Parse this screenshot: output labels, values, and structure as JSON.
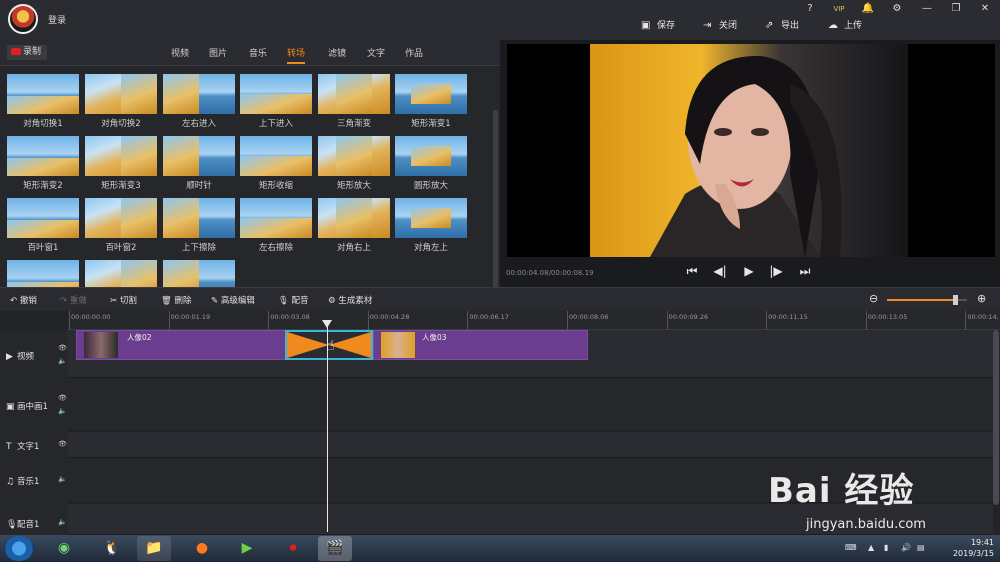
{
  "topbar": {
    "login": "登录",
    "window_buttons": [
      "?",
      "VIP",
      "🔔",
      "⚙",
      "—",
      "❐",
      "✕"
    ],
    "actions": [
      {
        "label": "保存",
        "icon": "save-icon"
      },
      {
        "label": "关闭",
        "icon": "close-project-icon"
      },
      {
        "label": "导出",
        "icon": "export-icon"
      },
      {
        "label": "上传",
        "icon": "upload-icon"
      }
    ]
  },
  "library": {
    "record_label": "录制",
    "tabs": [
      "视频",
      "图片",
      "音乐",
      "转场",
      "滤镜",
      "文字",
      "作品"
    ],
    "active_tab": "转场",
    "transitions": [
      "对角切换1",
      "对角切换2",
      "左右进入",
      "上下进入",
      "三角渐变",
      "矩形渐变1",
      "矩形渐变2",
      "矩形渐变3",
      "顺时针",
      "矩形收缩",
      "矩形放大",
      "圆形放大",
      "百叶窗1",
      "百叶窗2",
      "上下擦除",
      "左右擦除",
      "对角右上",
      "对角左上",
      "",
      "",
      ""
    ]
  },
  "preview": {
    "timecode": "00:00:04.08/00:00:08.19"
  },
  "edit_toolbar": {
    "undo": "撤销",
    "redo": "重做",
    "cut": "切割",
    "delete": "删除",
    "advanced": "高级编辑",
    "dub": "配音",
    "generate": "生成素材",
    "zoom_level": 0.85
  },
  "timeline": {
    "ruler": [
      "00:00:00.00",
      "00:00:01.19",
      "00:00:03.08",
      "00:00:04.28",
      "00:00:06.17",
      "00:00:08.06",
      "00:00:09.26",
      "00:00:11.15",
      "00:00:13.05",
      "00:00:14."
    ],
    "tracks": [
      "视频",
      "画中画1",
      "文字1",
      "音乐1",
      "配音1"
    ],
    "clips": [
      {
        "name": "人像02"
      },
      {
        "name": "人像03"
      }
    ]
  },
  "taskbar": {
    "time": "19:41",
    "date": "2019/3/15"
  },
  "watermark": {
    "brand": "Bai 经验",
    "url": "jingyan.baidu.com"
  }
}
